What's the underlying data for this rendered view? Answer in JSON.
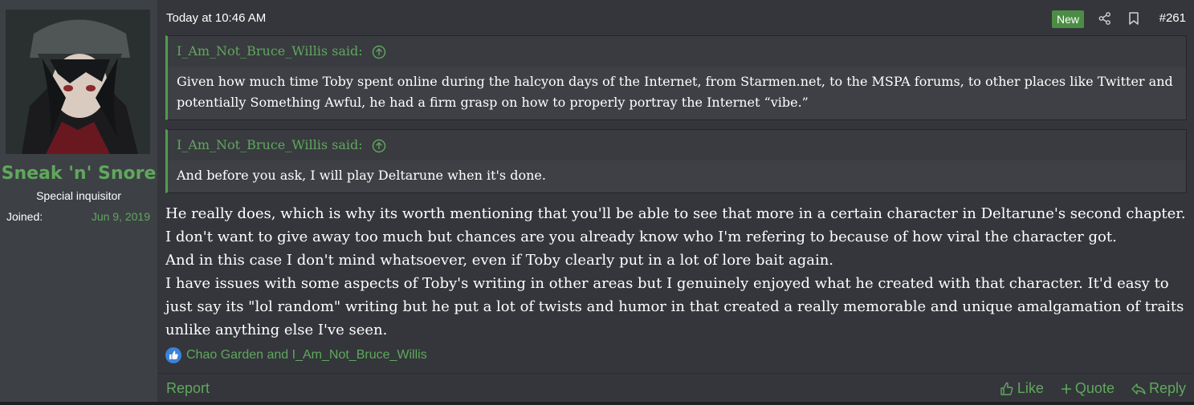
{
  "user": {
    "name": "Sneak 'n' Snore",
    "title": "Special inquisitor",
    "joined_label": "Joined:",
    "joined_value": "Jun 9, 2019"
  },
  "post": {
    "date": "Today at 10:46 AM",
    "badge": "New",
    "number": "#261",
    "quotes": [
      {
        "author": "I_Am_Not_Bruce_Willis said:",
        "text": "Given how much time Toby spent online during the halcyon days of the Internet, from Starmen.net, to the MSPA forums, to other places like Twitter and potentially Something Awful, he had a firm grasp on how to properly portray the Internet “vibe.”"
      },
      {
        "author": "I_Am_Not_Bruce_Willis said:",
        "text": "And before you ask, I will play Deltarune when it's done."
      }
    ],
    "body": [
      "He really does, which is why its worth mentioning that you'll be able to see that more in a certain character in Deltarune's second chapter.",
      "I don't want to give away too much but chances are you already know who I'm refering to because of how viral the character got.",
      "And in this case I don't mind whatsoever, even if Toby clearly put in a lot of lore bait again.",
      "I have issues with some aspects of Toby's writing in other areas but I genuinely enjoyed what he created with that character. It'd easy to just say its \"lol random\" writing but he put a lot of twists and humor in that created a really memorable and unique amalgamation of traits unlike anything else I've seen."
    ],
    "reactions": "Chao Garden and I_Am_Not_Bruce_Willis"
  },
  "footer": {
    "report": "Report",
    "like": "Like",
    "quote": "Quote",
    "reply": "Reply"
  },
  "icons": [
    "share-icon",
    "bookmark-icon",
    "arrow-up-circle-icon",
    "like-reaction-icon",
    "thumbs-up-icon",
    "plus-icon",
    "reply-icon"
  ],
  "colors": {
    "accent": "#5fa85c",
    "badge": "#4c8d45",
    "background": "#34363b",
    "sidebar": "#3d4045"
  }
}
